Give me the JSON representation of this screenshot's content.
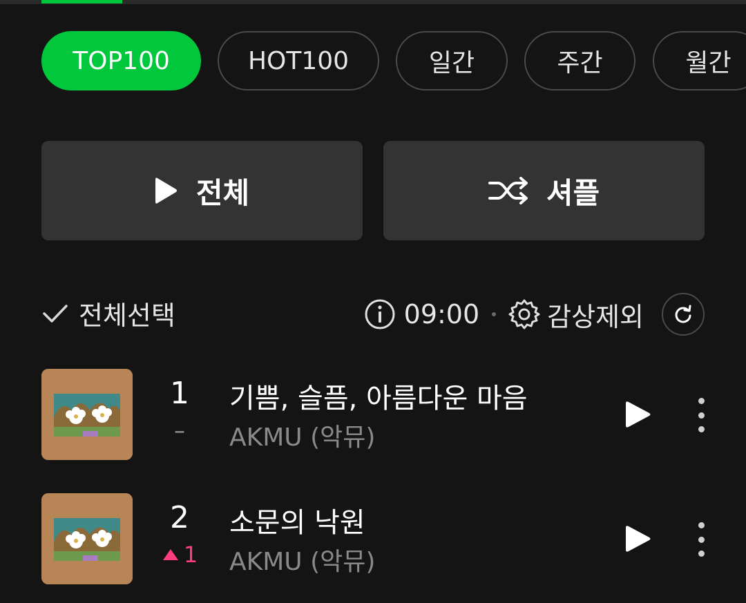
{
  "chips": [
    {
      "label": "TOP100",
      "active": true
    },
    {
      "label": "HOT100",
      "active": false
    },
    {
      "label": "일간",
      "active": false
    },
    {
      "label": "주간",
      "active": false
    },
    {
      "label": "월간",
      "active": false
    }
  ],
  "actions": {
    "play_all_label": "전체",
    "shuffle_label": "셔플"
  },
  "toolbar": {
    "select_all_label": "전체선택",
    "time": "09:00",
    "exclude_label": "감상제외"
  },
  "songs": [
    {
      "rank": "1",
      "change": "–",
      "title": "기쁨, 슬픔, 아름다운 마음",
      "artist": "AKMU (악뮤)"
    },
    {
      "rank": "2",
      "change": "1",
      "title": "소문의 낙원",
      "artist": "AKMU (악뮤)"
    }
  ],
  "colors": {
    "accent": "#00c73c",
    "background": "#141414",
    "button_bg": "#333333",
    "rank_up": "#ff3d7f"
  },
  "icons": [
    "play-icon",
    "shuffle-icon",
    "check-icon",
    "info-icon",
    "gear-icon",
    "refresh-icon",
    "more-vertical-icon",
    "up-triangle-icon"
  ]
}
